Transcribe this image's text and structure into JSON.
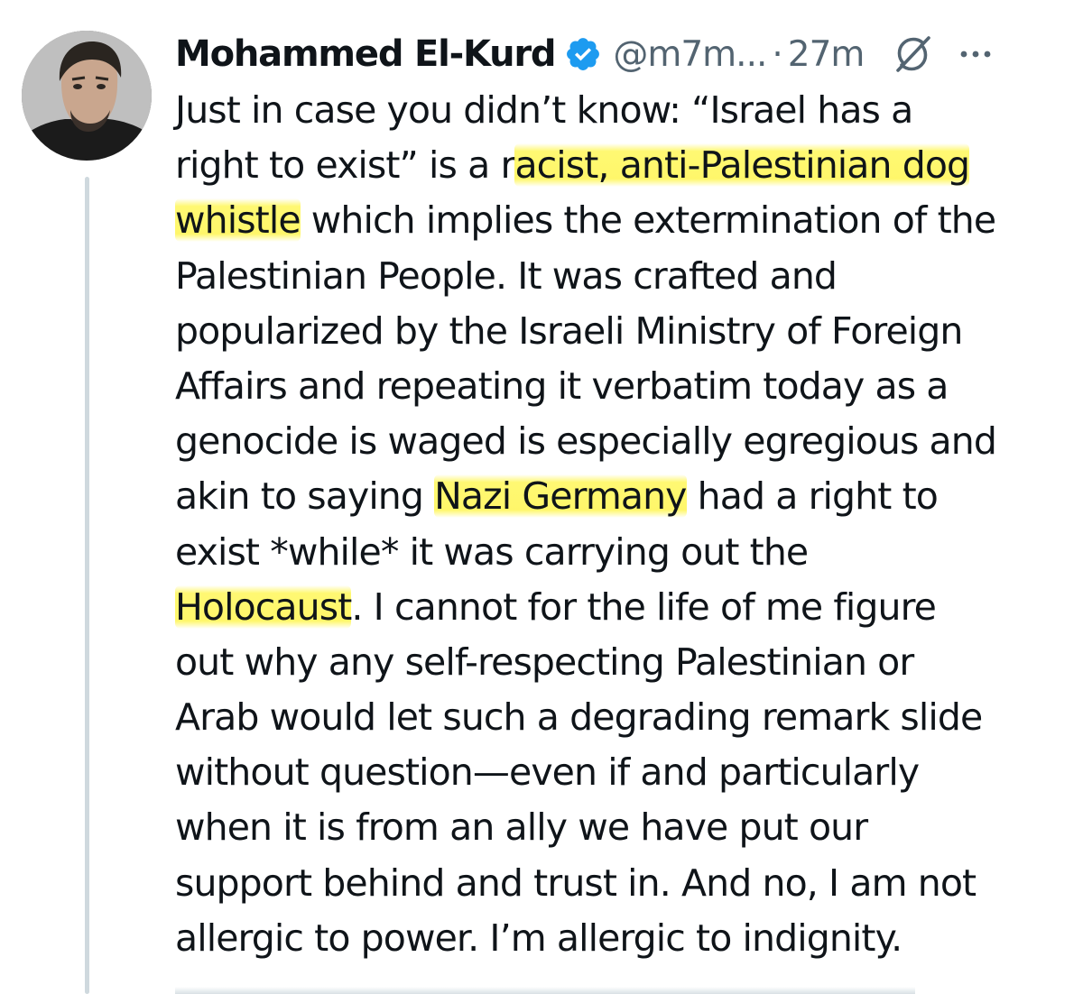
{
  "author": {
    "display_name": "Mohammed El-Kurd",
    "handle": "@m7m...",
    "separator": "·",
    "time_ago": "27m",
    "avatar_icon": "profile-photo",
    "verified_icon": "verified-badge-icon",
    "verified_color": "#1d9bf0"
  },
  "actions": {
    "grok_icon": "grok-icon",
    "more_icon": "more-options-icon"
  },
  "body": {
    "line1": "Just in case you didn’t know: “Israel has a",
    "line2_pre": "right to exist” is a r",
    "line2_hl": "acist, anti-Palestinian dog",
    "line3_hl": "whistle",
    "line3_post": " which implies the extermination of the",
    "line4": "Palestinian People. It was crafted and",
    "line5": "popularized by the Israeli Ministry of Foreign",
    "line6": "Affairs and repeating it verbatim today as a",
    "line7": "genocide is waged is especially egregious and",
    "line8_pre": "akin to saying ",
    "line8_hl": "Nazi Germany",
    "line8_post": " had a right to",
    "line9": "exist *while* it was carrying out the",
    "line10_hl": "Holocaust",
    "line10_post": ". I cannot for the life of me figure",
    "line11": "out why any self-respecting Palestinian or",
    "line12": "Arab would let such a degrading remark slide",
    "line13": "without question—even if and particularly",
    "line14": "when it is from an ally we have put our",
    "line15": "support behind and trust in. And no, I am not",
    "line16": "allergic to power. I’m allergic to indignity."
  },
  "colors": {
    "text": "#0f1419",
    "secondary_text": "#536471",
    "highlight": "#fff55a",
    "thread_line": "#cfd9de"
  }
}
